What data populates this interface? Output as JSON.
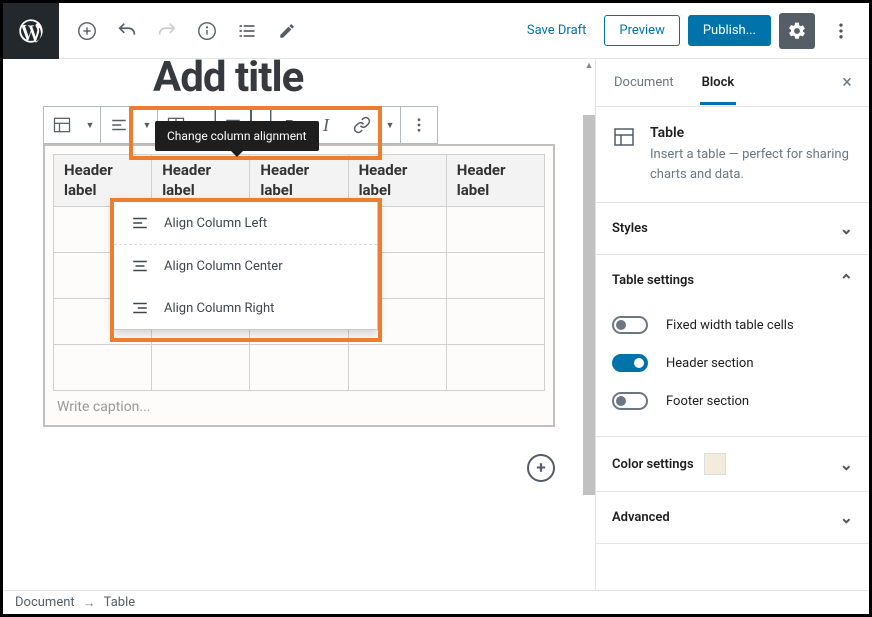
{
  "topbar": {
    "save_draft": "Save Draft",
    "preview": "Preview",
    "publish": "Publish..."
  },
  "tooltip": "Change column alignment",
  "dropdown": {
    "items": [
      {
        "label": "Align Column Left"
      },
      {
        "label": "Align Column Center"
      },
      {
        "label": "Align Column Right"
      }
    ]
  },
  "title_fragment": "Add title",
  "table": {
    "headers": [
      "Header label",
      "Header label",
      "Header label",
      "Header label",
      "Header label"
    ],
    "caption_placeholder": "Write caption..."
  },
  "sidebar": {
    "tabs": {
      "document": "Document",
      "block": "Block"
    },
    "block": {
      "name": "Table",
      "description": "Insert a table — perfect for sharing charts and data."
    },
    "panels": {
      "styles": "Styles",
      "table_settings": "Table settings",
      "color_settings": "Color settings",
      "advanced": "Advanced"
    },
    "toggles": {
      "fixed_width": "Fixed width table cells",
      "header_section": "Header section",
      "footer_section": "Footer section"
    }
  },
  "footer": {
    "document": "Document",
    "table": "Table"
  }
}
